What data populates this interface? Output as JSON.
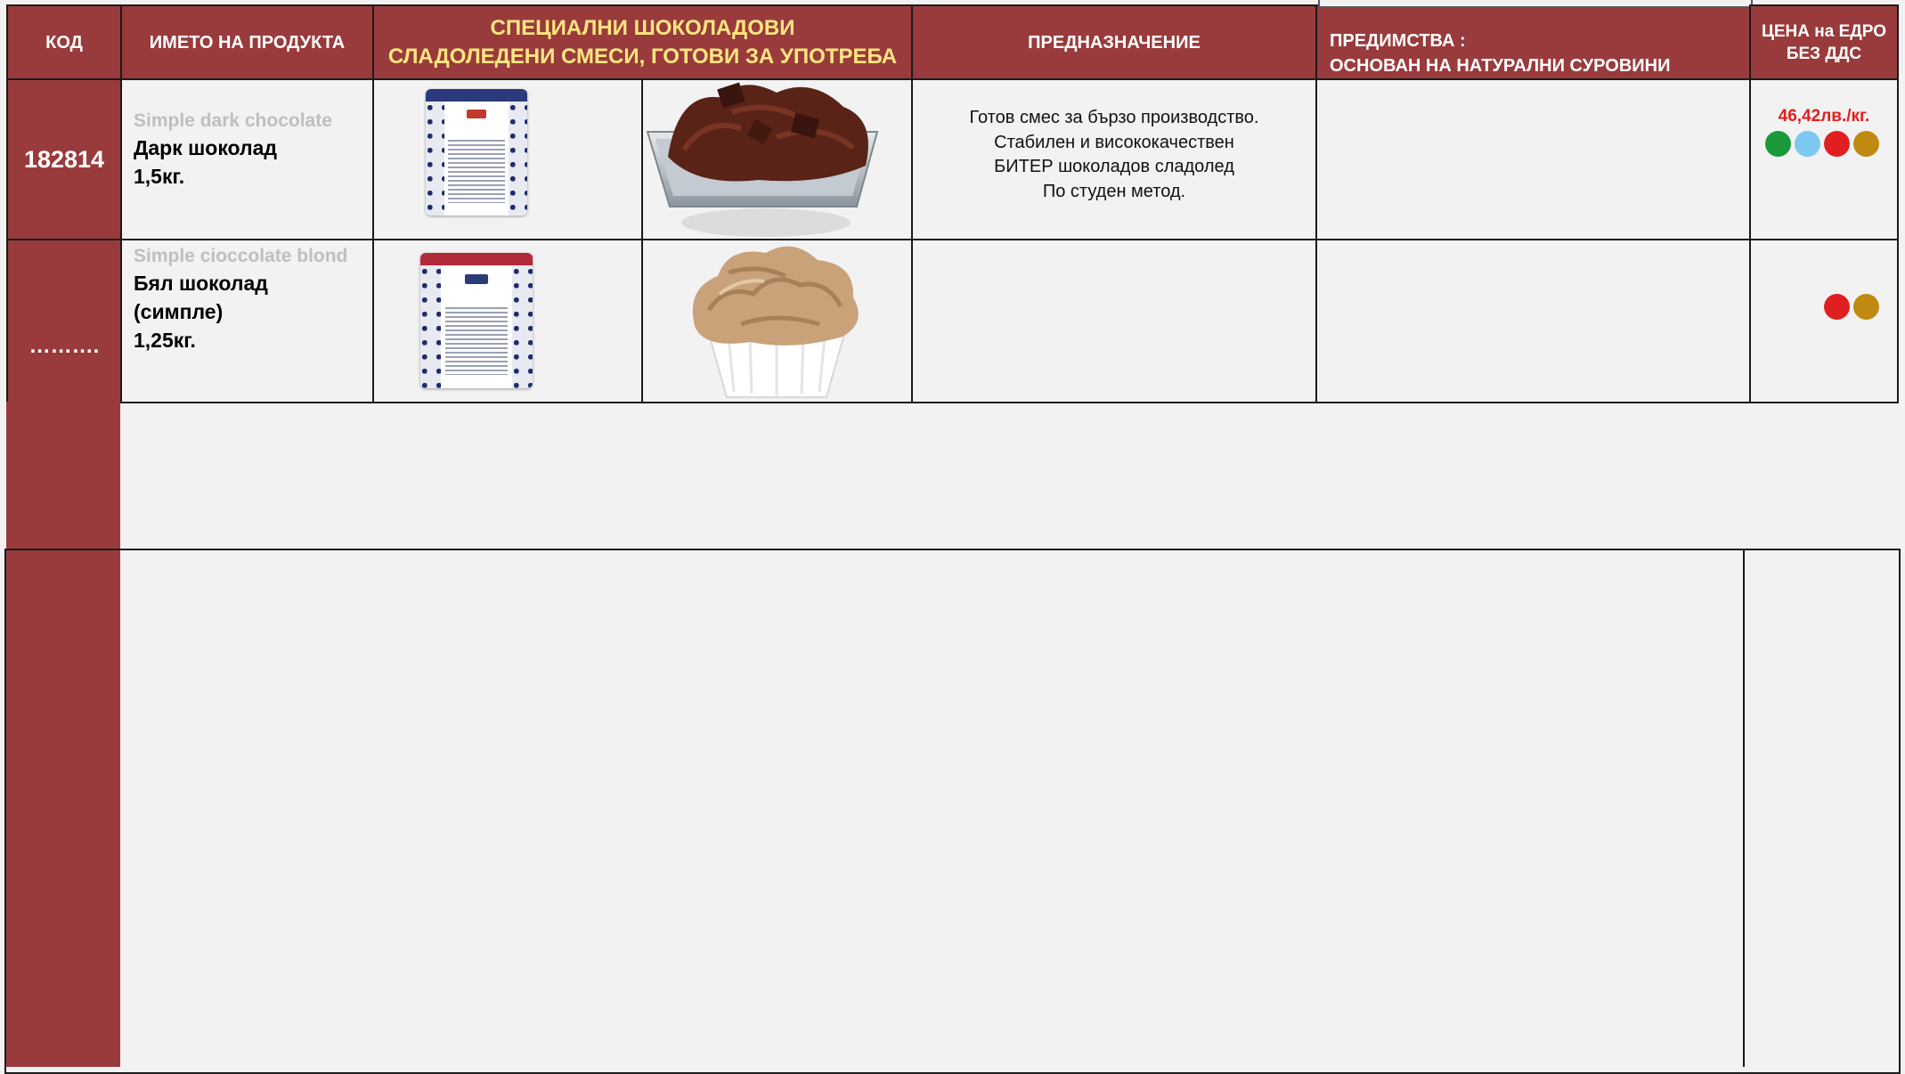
{
  "header": {
    "code": "КОД",
    "product_name": "ИМЕТО НА ПРОДУКТА",
    "category_line1": "СПЕЦИАЛНИ ШОКОЛАДОВИ",
    "category_line2": "СЛАДОЛЕДЕНИ СМЕСИ, ГОТОВИ ЗА УПОТРЕБА",
    "purpose": "ПРЕДНАЗНАЧЕНИЕ",
    "advantages_line1": "ПРЕДИМСТВА :",
    "advantages_line2": "ОСНОВАН НА НАТУРАЛНИ СУРОВИНИ",
    "price_line1": "ЦЕНА на ЕДРО",
    "price_line2": "БЕЗ ДДС"
  },
  "rows": [
    {
      "code": "182814",
      "latin_name": "Simple  dark chocolate",
      "name_line1": "Дарк шоколад",
      "name_line2": "1,5кг.",
      "purpose_lines": [
        "Готов смес за бързо производство.",
        "Стабилен и висококачествен",
        "БИТЕР шоколадов сладолед",
        "По студен метод."
      ],
      "price": "46,42лв./кг.",
      "dots": [
        "#1a9a3a",
        "#7cc8ee",
        "#e02020",
        "#c08a10"
      ]
    },
    {
      "code": "……….",
      "latin_name": "Simple  cioccolate blond",
      "name_line1": "Бял шоколад",
      "name_line2": "(симпле)",
      "name_line3": "1,25кг.",
      "dots": [
        "#e02020",
        "#c08a10"
      ]
    }
  ],
  "colors": {
    "header_bg": "#993b3c",
    "accent_yellow": "#ffe680",
    "price_red": "#e02020"
  }
}
